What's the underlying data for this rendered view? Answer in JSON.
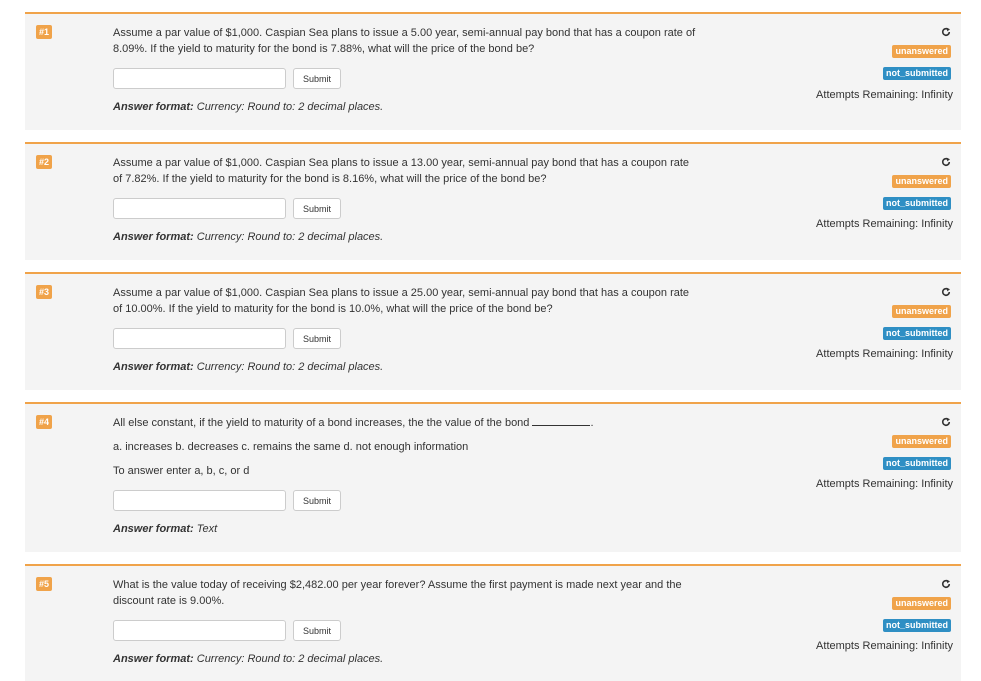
{
  "common": {
    "submit_label": "Submit",
    "answer_format_label": "Answer format:",
    "badge_unanswered": "unanswered",
    "badge_not_submitted": "not_submitted",
    "attempts_text": "Attempts Remaining: Infinity",
    "icon": "reload-icon",
    "colors": {
      "accent_orange": "#f0a34a",
      "badge_blue": "#2f8fc4",
      "panel_bg": "#f4f4f4"
    }
  },
  "questions": [
    {
      "number": "#1",
      "lines": [
        "Assume a par value of $1,000. Caspian Sea plans to issue a 5.00 year, semi-annual pay bond that has a coupon rate of",
        "8.09%. If the yield to maturity for the bond is 7.88%, what will the price of the bond be?"
      ],
      "answer_value": "",
      "answer_format": "Currency: Round to: 2 decimal places."
    },
    {
      "number": "#2",
      "lines": [
        "Assume a par value of $1,000. Caspian Sea plans to issue a 13.00 year, semi-annual pay bond that has a coupon rate",
        "of 7.82%. If the yield to maturity for the bond is 8.16%, what will the price of the bond be?"
      ],
      "answer_value": "",
      "answer_format": "Currency: Round to: 2 decimal places."
    },
    {
      "number": "#3",
      "lines": [
        "Assume a par value of $1,000. Caspian Sea plans to issue a 25.00 year, semi-annual pay bond that has a coupon rate",
        "of 10.00%. If the yield to maturity for the bond is 10.0%, what will the price of the bond be?"
      ],
      "answer_value": "",
      "answer_format": "Currency: Round to: 2 decimal places."
    },
    {
      "number": "#4",
      "line1": "All else constant, if the yield to maturity of a bond increases, the the value of the bond",
      "line1_end": ".",
      "line2": "a. increases b. decreases c. remains the same d. not enough information",
      "line3": "To answer enter a, b, c, or d",
      "answer_value": "",
      "answer_format": "Text"
    },
    {
      "number": "#5",
      "lines": [
        "What is the value today of receiving $2,482.00 per year forever? Assume the first payment is made next year and the",
        "discount rate is 9.00%."
      ],
      "answer_value": "",
      "answer_format": "Currency: Round to: 2 decimal places."
    }
  ]
}
